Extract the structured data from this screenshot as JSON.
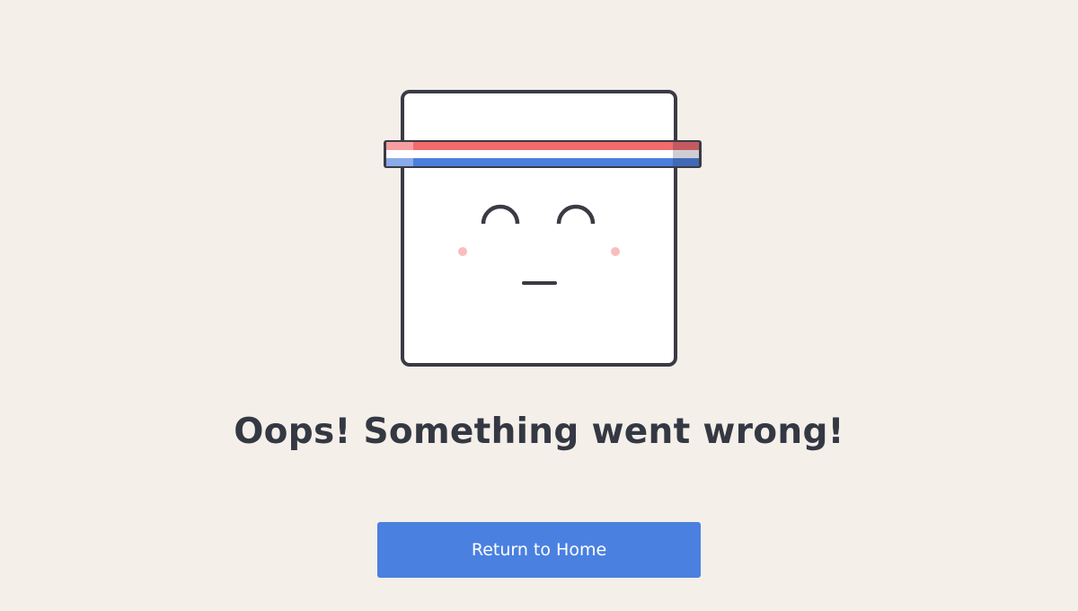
{
  "page": {
    "title": "Oops! Something went wrong!",
    "button_label": "Return to Home"
  },
  "colors": {
    "background": "#f4efe9",
    "text": "#343843",
    "button": "#4a80e0",
    "button_text": "#ffffff",
    "outline": "#3a3b45",
    "face": "#ffffff",
    "band_red": "#f36b6d",
    "band_blue": "#4a7fdd",
    "cheek": "#f9bdbf"
  },
  "icons": {
    "mascot": "sweatband-box-face-icon"
  }
}
